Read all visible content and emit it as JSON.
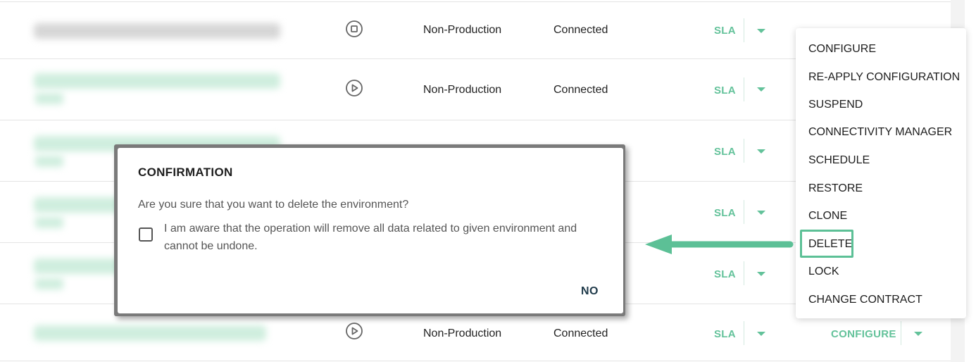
{
  "rows": [
    {
      "environment": "Non-Production",
      "status": "Connected",
      "sla": "SLA"
    },
    {
      "environment": "Non-Production",
      "status": "Connected",
      "sla": "SLA"
    },
    {
      "sla": "SLA"
    },
    {
      "sla": "SLA"
    },
    {
      "sla": "SLA"
    },
    {
      "environment": "Non-Production",
      "status": "Connected",
      "sla": "SLA",
      "action": "CONFIGURE"
    }
  ],
  "action_menu": {
    "items": [
      "CONFIGURE",
      "RE-APPLY CONFIGURATION",
      "SUSPEND",
      "CONNECTIVITY MANAGER",
      "SCHEDULE",
      "RESTORE",
      "CLONE",
      "DELETE",
      "LOCK",
      "CHANGE CONTRACT"
    ],
    "highlighted": "DELETE"
  },
  "dialog": {
    "title": "CONFIRMATION",
    "question": "Are you sure that you want to delete the environment?",
    "checkbox_label": "I am aware that the operation will remove all data related to given environment and cannot be undone.",
    "no_label": "NO"
  },
  "colors": {
    "accent": "#63c29a",
    "highlight_border": "#5cc096",
    "arrow": "#5cc096"
  }
}
